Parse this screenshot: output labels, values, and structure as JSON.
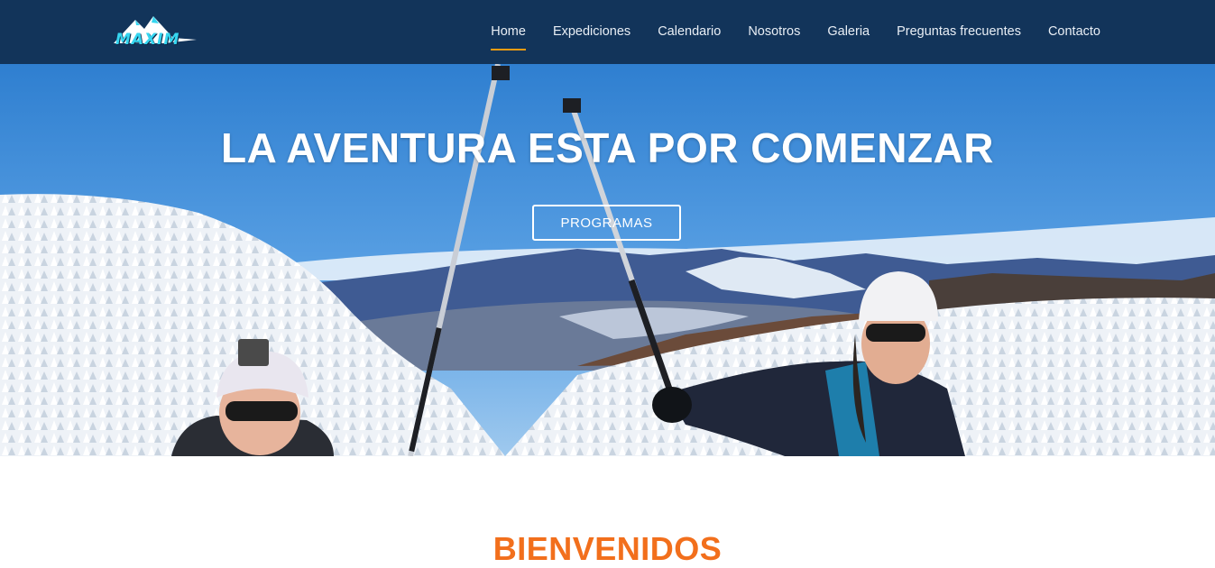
{
  "header": {
    "logo_text": "MAXIM",
    "nav": [
      {
        "label": "Home",
        "active": true
      },
      {
        "label": "Expediciones",
        "active": false
      },
      {
        "label": "Calendario",
        "active": false
      },
      {
        "label": "Nosotros",
        "active": false
      },
      {
        "label": "Galeria",
        "active": false
      },
      {
        "label": "Preguntas frecuentes",
        "active": false
      },
      {
        "label": "Contacto",
        "active": false
      }
    ]
  },
  "hero": {
    "title": "LA AVENTURA ESTA POR COMENZAR",
    "button_label": "PROGRAMAS"
  },
  "welcome": {
    "heading": "BIENVENIDOS"
  },
  "colors": {
    "navbar_bg": "#12345a",
    "active_underline": "#f39c12",
    "heading_accent": "#f26f1c",
    "logo_accent": "#36d6f0"
  }
}
